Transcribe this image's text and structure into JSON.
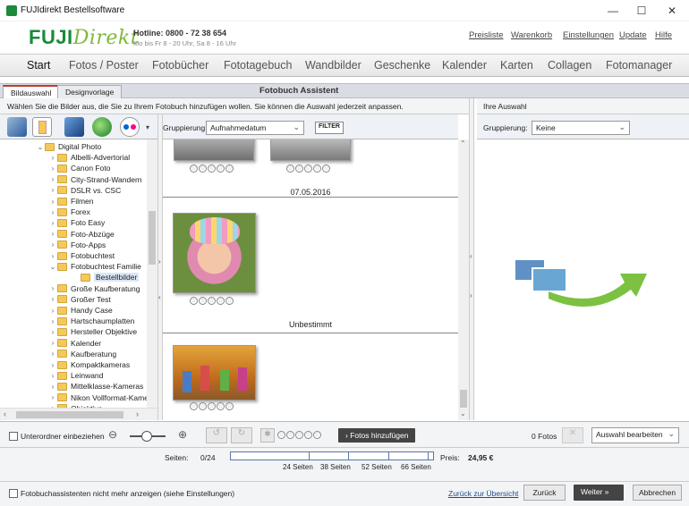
{
  "window": {
    "title": "FUJIdirekt Bestellsoftware",
    "minimize": "—",
    "maximize": "☐",
    "close": "✕"
  },
  "header": {
    "logo_fuji": "FUJI",
    "logo_direkt": "Direkt",
    "hotline": "Hotline: 0800 - 72 38 654",
    "hours": "Mo bis Fr 8 - 20 Uhr, Sa 8 - 16 Uhr",
    "links": [
      "Preisliste",
      "Warenkorb",
      "Einstellungen",
      "Update",
      "Hilfe"
    ]
  },
  "nav": {
    "items": [
      "Start",
      "Fotos / Poster",
      "Fotobücher",
      "Fototagebuch",
      "Wandbilder",
      "Geschenke",
      "Kalender",
      "Karten",
      "Collagen",
      "Fotomanager"
    ],
    "active": "Start"
  },
  "tabs": [
    "Bildauswahl",
    "Designvorlage"
  ],
  "assistant_title": "Fotobuch Assistent",
  "instruction": "Wählen Sie die Bilder aus, die Sie zu Ihrem Fotobuch hinzufügen wollen. Sie können die Auswahl jederzeit anpassen.",
  "left": {
    "gruppierung_label": "Gruppierung:",
    "gruppierung_value": "Aufnahmedatum",
    "filter_label": "FILTER",
    "tree": [
      {
        "label": "Digital Photo",
        "chev": "⌄",
        "level": 0
      },
      {
        "label": "Albelli-Advertorial",
        "chev": "›",
        "level": 1
      },
      {
        "label": "Canon Foto",
        "chev": "›",
        "level": 1
      },
      {
        "label": "City-Strand-Wandern",
        "chev": "›",
        "level": 1
      },
      {
        "label": "DSLR vs. CSC",
        "chev": "›",
        "level": 1
      },
      {
        "label": "Filmen",
        "chev": "›",
        "level": 1
      },
      {
        "label": "Forex",
        "chev": "›",
        "level": 1
      },
      {
        "label": "Foto Easy",
        "chev": "›",
        "level": 1
      },
      {
        "label": "Foto-Abzüge",
        "chev": "›",
        "level": 1
      },
      {
        "label": "Foto-Apps",
        "chev": "›",
        "level": 1
      },
      {
        "label": "Fotobuchtest",
        "chev": "›",
        "level": 1
      },
      {
        "label": "Fotobuchtest Familie",
        "chev": "⌄",
        "level": 1
      },
      {
        "label": "Bestellbilder",
        "chev": "",
        "level": 2,
        "selected": true
      },
      {
        "label": "Große Kaufberatung",
        "chev": "›",
        "level": 1
      },
      {
        "label": "Großer Test",
        "chev": "›",
        "level": 1
      },
      {
        "label": "Handy Case",
        "chev": "›",
        "level": 1
      },
      {
        "label": "Hartschaumplatten",
        "chev": "›",
        "level": 1
      },
      {
        "label": "Hersteller Objektive",
        "chev": "›",
        "level": 1
      },
      {
        "label": "Kalender",
        "chev": "›",
        "level": 1
      },
      {
        "label": "Kaufberatung",
        "chev": "›",
        "level": 1
      },
      {
        "label": "Kompaktkameras",
        "chev": "›",
        "level": 1
      },
      {
        "label": "Leinwand",
        "chev": "›",
        "level": 1
      },
      {
        "label": "Mittelklasse-Kameras",
        "chev": "›",
        "level": 1
      },
      {
        "label": "Nikon Vollformat-Kame",
        "chev": "›",
        "level": 1
      },
      {
        "label": "Objektive",
        "chev": "›",
        "level": 1
      }
    ],
    "date_headers": [
      "07.05.2016",
      "Unbestimmt"
    ],
    "include_subfolders": "Unterordner einbeziehen",
    "add_photos": "Fotos hinzufügen"
  },
  "right": {
    "title": "Ihre Auswahl",
    "gruppierung_label": "Gruppierung:",
    "gruppierung_value": "Keine",
    "photo_count": "0 Fotos",
    "edit_selection": "Auswahl bearbeiten"
  },
  "pages": {
    "label": "Seiten:",
    "value": "0/24",
    "progress": 0,
    "marks": [
      "24 Seiten",
      "38 Seiten",
      "52 Seiten",
      "66 Seiten"
    ],
    "price_label": "Preis:",
    "price": "24,95 €"
  },
  "footer": {
    "dont_show": "Fotobuchassistenten nicht mehr anzeigen (siehe Einstellungen)",
    "back_to_overview": "Zurück zur Übersicht",
    "back": "Zurück",
    "next": "Weiter",
    "cancel": "Abbrechen"
  }
}
